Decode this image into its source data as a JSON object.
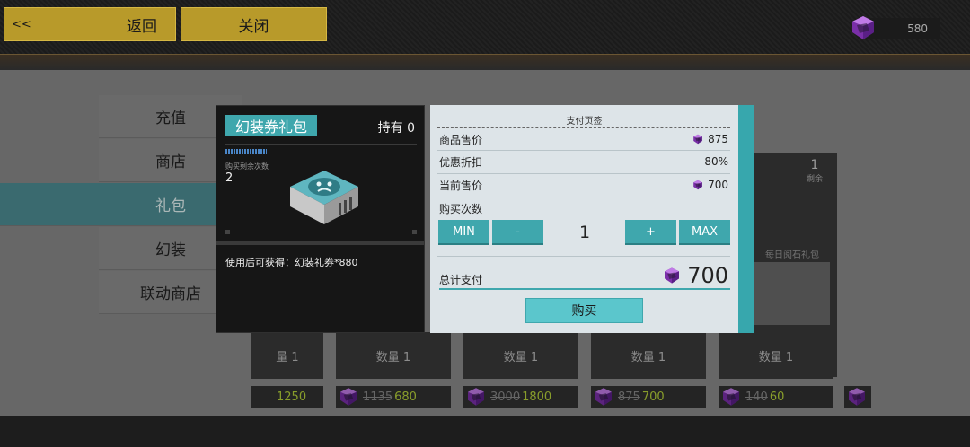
{
  "topbar": {
    "back_chevron": "<<",
    "back_label": "返回",
    "close_label": "关闭",
    "currency_amount": "580",
    "currency_icon": "purple-gem-icon"
  },
  "sidebar": {
    "items": [
      {
        "label": "充值",
        "active": false
      },
      {
        "label": "商店",
        "active": false
      },
      {
        "label": "礼包",
        "active": true
      },
      {
        "label": "幻装",
        "active": false
      },
      {
        "label": "联动商店",
        "active": false
      }
    ]
  },
  "background_cards": {
    "qty_labels": [
      "量 1",
      "数量 1",
      "数量 1",
      "数量 1",
      "数量 1"
    ],
    "prices": [
      {
        "old": "",
        "new": "1250"
      },
      {
        "old": "1135",
        "new": "680"
      },
      {
        "old": "3000",
        "new": "1800"
      },
      {
        "old": "875",
        "new": "700"
      },
      {
        "old": "140",
        "new": "60"
      }
    ],
    "right_card_title": "每日阅石礼包",
    "right_card_remain_value": "1",
    "right_card_remain_label": "剩余"
  },
  "item_panel": {
    "title": "幻装券礼包",
    "own_label": "持有 0",
    "remain_label": "购买剩余次数",
    "remain_value": "2",
    "description": "使用后可获得：幻装礼券*880"
  },
  "payment": {
    "title": "支付页签",
    "price_label": "商品售价",
    "price_value": "875",
    "discount_label": "优惠折扣",
    "discount_value": "80%",
    "current_label": "当前售价",
    "current_value": "700",
    "qty_label": "购买次数",
    "min_label": "MIN",
    "minus_label": "-",
    "qty_value": "1",
    "plus_label": "+",
    "max_label": "MAX",
    "total_label": "总计支付",
    "total_value": "700",
    "buy_label": "购买"
  },
  "colors": {
    "accent_teal": "#3fa7ad",
    "gold": "#b89a2a",
    "gem_purple": "#8a3fb8",
    "price_green": "#b6d23a"
  }
}
